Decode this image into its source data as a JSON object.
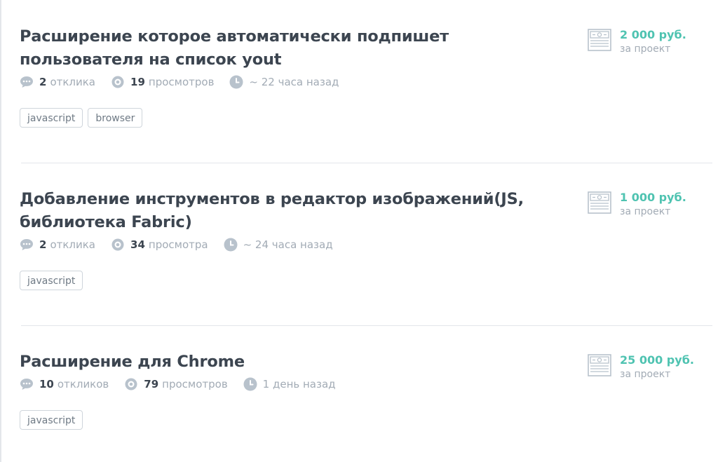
{
  "tasks": [
    {
      "title": "Расширение которое автоматически подпишет пользователя на список yout",
      "responses": {
        "count": "2",
        "label": "отклика"
      },
      "views": {
        "count": "19",
        "label": "просмотров"
      },
      "time": "~ 22 часа назад",
      "tags": [
        "javascript",
        "browser"
      ],
      "price": "2 000 руб.",
      "price_note": "за проект"
    },
    {
      "title": "Добавление инструментов в редактор изображений(JS, библиотека Fabric)",
      "responses": {
        "count": "2",
        "label": "отклика"
      },
      "views": {
        "count": "34",
        "label": "просмотра"
      },
      "time": "~ 24 часа назад",
      "tags": [
        "javascript"
      ],
      "price": "1 000 руб.",
      "price_note": "за проект"
    },
    {
      "title": "Расширение для Chrome",
      "responses": {
        "count": "10",
        "label": "откликов"
      },
      "views": {
        "count": "79",
        "label": "просмотров"
      },
      "time": "1 день назад",
      "tags": [
        "javascript"
      ],
      "price": "25 000 руб.",
      "price_note": "за проект"
    }
  ],
  "icons": {
    "responses": "speech-bubble-icon",
    "views": "eye-icon",
    "time": "clock-icon",
    "price": "banknote-icon"
  },
  "colors": {
    "title": "#3c4550",
    "muted": "#a2abb5",
    "accent": "#4fc3b1",
    "icon": "#b8c2cc"
  }
}
